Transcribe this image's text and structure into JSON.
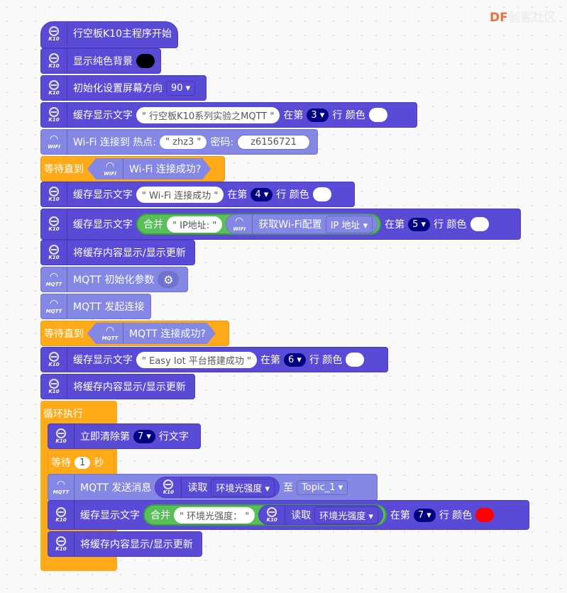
{
  "watermark": {
    "brand": "DF",
    "suffix": "创客社区"
  },
  "colors": {
    "k10": "#5a4bd6",
    "wifi": "#8488e4",
    "control": "#ffab19",
    "operator": "#59c059",
    "row_badge": "#000080",
    "bg_color_black": "#000000",
    "text_color_white": "#ffffff",
    "text_color_red": "#ff0000"
  },
  "icons": {
    "k10": "k10-board-icon",
    "wifi": "wifi-icon",
    "mqtt": "mqtt-wifi-icon",
    "gear": "gear-icon"
  },
  "labels": {
    "k10": "K10",
    "wifi": "WIFI",
    "mqtt": "MQTT"
  },
  "b1": {
    "text": "行空板K10主程序开始"
  },
  "b2": {
    "text": "显示纯色背景"
  },
  "b3": {
    "text": "初始化设置屏幕方向",
    "value": "90 ▾"
  },
  "b4": {
    "text": "缓存显示文字",
    "str": "\" 行空板K10系列实验之MQTT \"",
    "at": "在第",
    "row": "3 ▾",
    "color": "行 颜色"
  },
  "b5": {
    "text": "Wi-Fi 连接到 热点:",
    "ssid": "\" zhz3 \"",
    "pwd_label": "密码:",
    "pwd": "z6156721"
  },
  "b6": {
    "text": "等待直到",
    "cond": "Wi-Fi 连接成功?"
  },
  "b7": {
    "text": "缓存显示文字",
    "str": "\" Wi-Fi 连接成功 \"",
    "at": "在第",
    "row": "4 ▾",
    "color": "行 颜色"
  },
  "b8": {
    "text": "缓存显示文字",
    "join": "合并",
    "str": "\" IP地址: \"",
    "get": "获取Wi-Fi配置",
    "opt": "IP 地址 ▾",
    "at": "在第",
    "row": "5 ▾",
    "color": "行 颜色"
  },
  "b9": {
    "text": "将缓存内容显示/显示更新"
  },
  "b10": {
    "text": "MQTT 初始化参数"
  },
  "b11": {
    "text": "MQTT 发起连接"
  },
  "b12": {
    "text": "等待直到",
    "cond": "MQTT 连接成功?"
  },
  "b13": {
    "text": "缓存显示文字",
    "str": "\" Easy Iot 平台搭建成功 \"",
    "at": "在第",
    "row": "6 ▾",
    "color": "行 颜色"
  },
  "b14": {
    "text": "将缓存内容显示/显示更新"
  },
  "b15": {
    "text": "循环执行"
  },
  "b16": {
    "text": "立即清除第",
    "row": "7 ▾",
    "suffix": "行文字"
  },
  "b17": {
    "text": "等待",
    "value": "1",
    "unit": "秒"
  },
  "b18": {
    "text": "MQTT 发送消息",
    "read": "读取",
    "opt": "环境光强度 ▾",
    "to": "至",
    "topic": "Topic_1 ▾"
  },
  "b19": {
    "text": "缓存显示文字",
    "join": "合并",
    "str": "\" 环境光强度： \"",
    "read": "读取",
    "opt": "环境光强度 ▾",
    "at": "在第",
    "row": "7 ▾",
    "color": "行 颜色"
  },
  "b20": {
    "text": "将缓存内容显示/显示更新"
  }
}
